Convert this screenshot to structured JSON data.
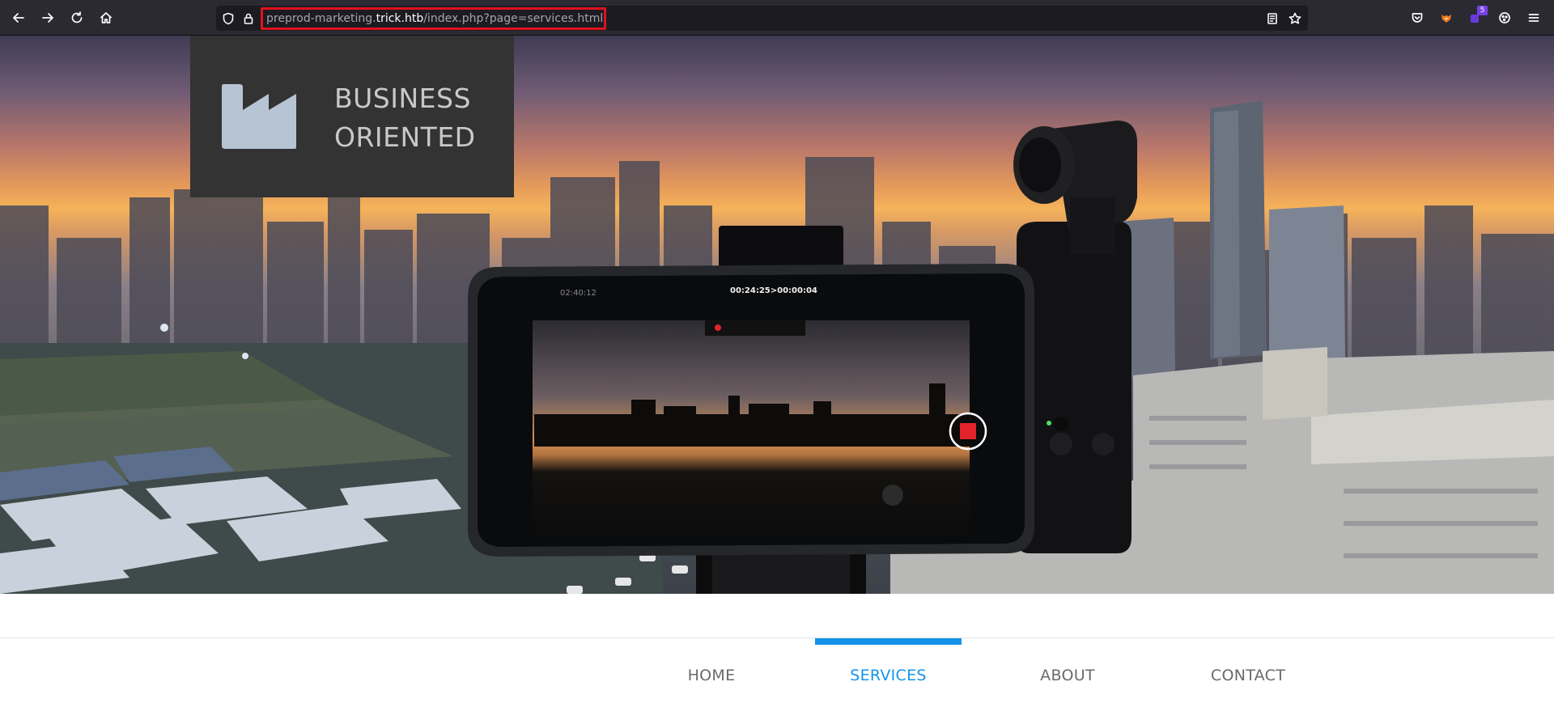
{
  "browser": {
    "url": {
      "prefix": "preprod-marketing.",
      "host": "trick.htb",
      "path": "/index.php?page=services.html"
    },
    "extension_badge_count": "5",
    "icons": {
      "back": "arrow-left-icon",
      "forward": "arrow-right-icon",
      "reload": "reload-icon",
      "home": "home-icon",
      "shield": "tracking-protection-shield-icon",
      "lock": "lock-icon",
      "reader": "reader-view-icon",
      "bookmark": "star-icon",
      "pocket": "pocket-icon",
      "menu": "hamburger-menu-icon"
    }
  },
  "site": {
    "brand": {
      "line1": "BUSINESS",
      "line2": "ORIENTED"
    },
    "phone_overlay": {
      "rec_timer": "00:24:25>00:00:04",
      "battery_time": "02:40:12"
    },
    "nav": [
      {
        "label": "HOME",
        "active": false
      },
      {
        "label": "SERVICES",
        "active": true
      },
      {
        "label": "ABOUT",
        "active": false
      },
      {
        "label": "CONTACT",
        "active": false
      }
    ]
  },
  "colors": {
    "accent": "#1494e9",
    "toolbar": "#2b2a33",
    "url_highlight": "#e0121c",
    "brand_box": "#333333"
  }
}
